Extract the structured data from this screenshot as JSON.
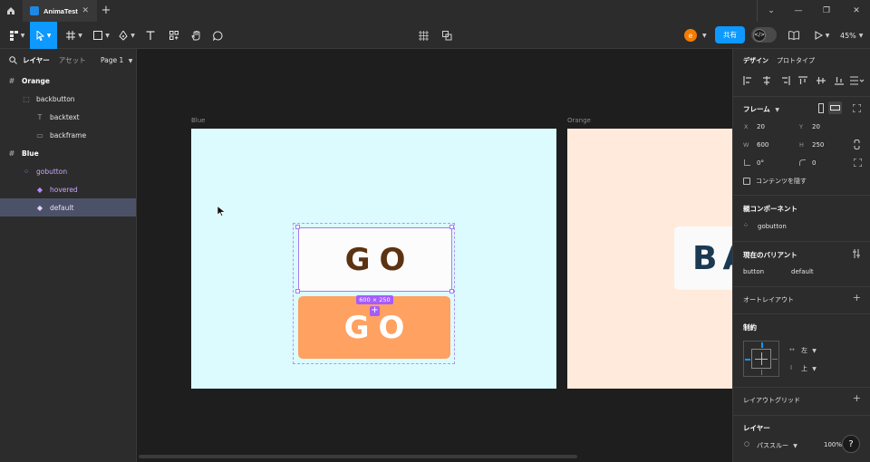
{
  "titlebar": {
    "tab_title": "AnimaTest",
    "tab_close": "✕",
    "new_tab": "+",
    "win_chevron": "⌄",
    "win_min": "—",
    "win_max": "❐",
    "win_close": "✕"
  },
  "toolbar": {
    "avatar_letter": "e",
    "share_label": "共有",
    "zoom": "45%"
  },
  "left_panel": {
    "tab_layers": "レイヤー",
    "tab_assets": "アセット",
    "page": "Page 1",
    "layers": [
      {
        "name": "Orange",
        "type": "frame"
      },
      {
        "name": "backbutton",
        "type": "group"
      },
      {
        "name": "backtext",
        "type": "text"
      },
      {
        "name": "backframe",
        "type": "rect"
      },
      {
        "name": "Blue",
        "type": "frame"
      },
      {
        "name": "gobutton",
        "type": "component-set"
      },
      {
        "name": "hovered",
        "type": "variant"
      },
      {
        "name": "default",
        "type": "variant",
        "selected": true
      }
    ]
  },
  "canvas": {
    "blue_label": "Blue",
    "orange_label": "Orange",
    "go_hover_text": "GO",
    "go_default_text": "GO",
    "back_text": "BA",
    "dim_badge": "600 × 250",
    "colors": {
      "blue_frame": "#dcfbff",
      "orange_frame": "#ffeadb",
      "go_hover_text": "#5c3312",
      "go_default_bg": "#ffa161",
      "back_text": "#1b3a52",
      "selection": "#a55cff"
    }
  },
  "right_panel": {
    "tab_design": "デザイン",
    "tab_prototype": "プロトタイプ",
    "frame_title": "フレーム",
    "x_label": "X",
    "x_value": "20",
    "y_label": "Y",
    "y_value": "20",
    "w_label": "W",
    "w_value": "600",
    "h_label": "H",
    "h_value": "250",
    "rotation": "0°",
    "radius": "0",
    "clip_content": "コンテンツを隠す",
    "parent_component_title": "親コンポーネント",
    "parent_component": "gobutton",
    "variant_title": "現在のバリアント",
    "variant_prop": "button",
    "variant_value": "default",
    "auto_layout": "オートレイアウト",
    "constraints_title": "制約",
    "constraint_h": "左",
    "constraint_v": "上",
    "layout_grid": "レイアウトグリッド",
    "layer_title": "レイヤー",
    "blend_mode": "パススルー",
    "opacity": "100%",
    "help": "?"
  }
}
